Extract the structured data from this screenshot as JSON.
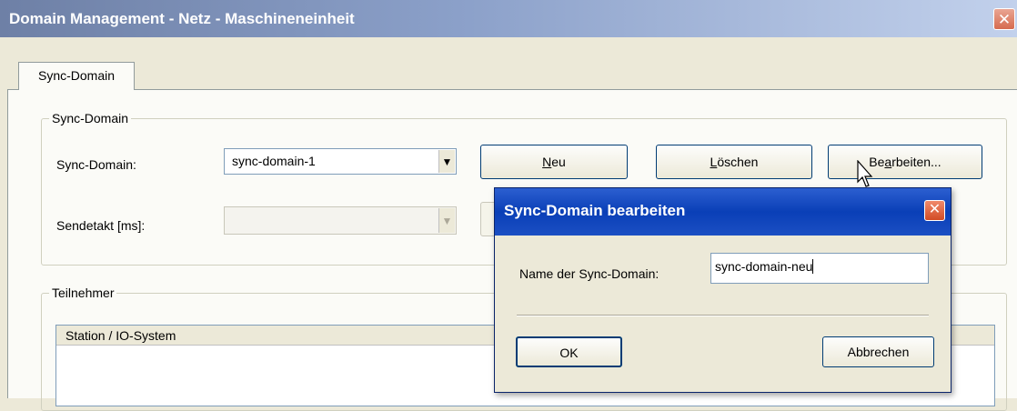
{
  "window": {
    "title": "Domain Management - Netz - Maschineneinheit",
    "close_glyph": "✕"
  },
  "tabs": [
    {
      "label": "Sync-Domain",
      "selected": true
    }
  ],
  "sync_group": {
    "title": "Sync-Domain",
    "domain_label": "Sync-Domain:",
    "domain_value": "sync-domain-1",
    "sendetakt_label": "Sendetakt [ms]:",
    "sendetakt_value": "",
    "buttons": {
      "new_prefix": "",
      "new_mnemonic": "N",
      "new_rest": "eu",
      "delete_prefix": "",
      "delete_mnemonic": "L",
      "delete_rest": "öschen",
      "edit_prefix": "Be",
      "edit_mnemonic": "a",
      "edit_rest": "rbeiten..."
    }
  },
  "teilnehmer_group": {
    "title": "Teilnehmer",
    "columns": [
      "Station / IO-System"
    ]
  },
  "dialog": {
    "title": "Sync-Domain bearbeiten",
    "close_glyph": "✕",
    "name_label": "Name der Sync-Domain:",
    "name_value": "sync-domain-neu",
    "ok_label": "OK",
    "cancel_label": "Abbrechen"
  },
  "icons": {
    "dropdown": "▼",
    "cursor": "mouse-pointer-icon"
  }
}
